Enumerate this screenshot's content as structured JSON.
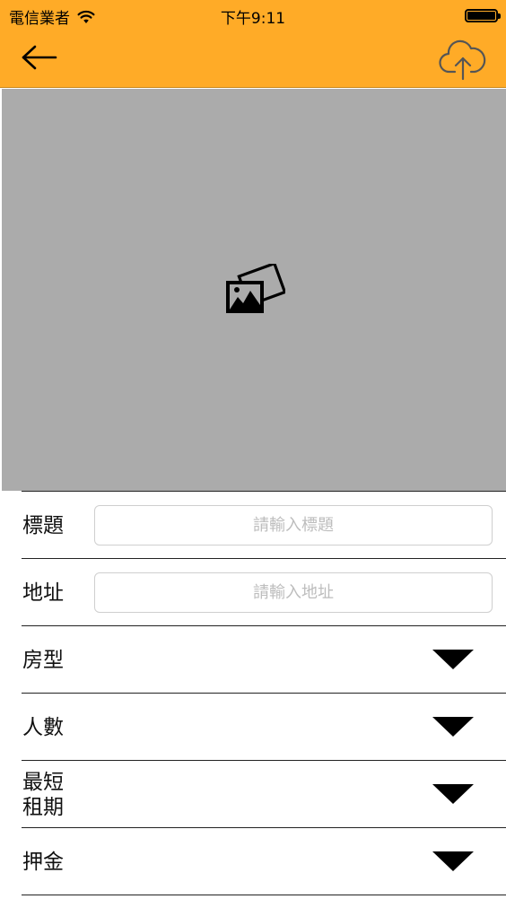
{
  "status_bar": {
    "carrier": "電信業者",
    "time": "下午9:11",
    "wifi_icon": "wifi-icon",
    "battery_icon": "battery-full-icon"
  },
  "nav_bar": {
    "back_icon": "arrow-left-icon",
    "upload_icon": "cloud-upload-icon",
    "background_color": "#FFAB27"
  },
  "photo_area": {
    "icon": "add-photos-icon",
    "background_color": "#ABABAB"
  },
  "form": {
    "title": {
      "label": "標題",
      "placeholder": "請輸入標題",
      "value": ""
    },
    "address": {
      "label": "地址",
      "placeholder": "請輸入地址",
      "value": ""
    },
    "room_type": {
      "label": "房型",
      "icon": "dropdown-triangle-icon"
    },
    "occupancy": {
      "label": "人數",
      "icon": "dropdown-triangle-icon"
    },
    "min_lease": {
      "label_line1": "最短",
      "label_line2": "租期",
      "icon": "dropdown-triangle-icon"
    },
    "deposit": {
      "label": "押金",
      "icon": "dropdown-triangle-icon"
    }
  }
}
